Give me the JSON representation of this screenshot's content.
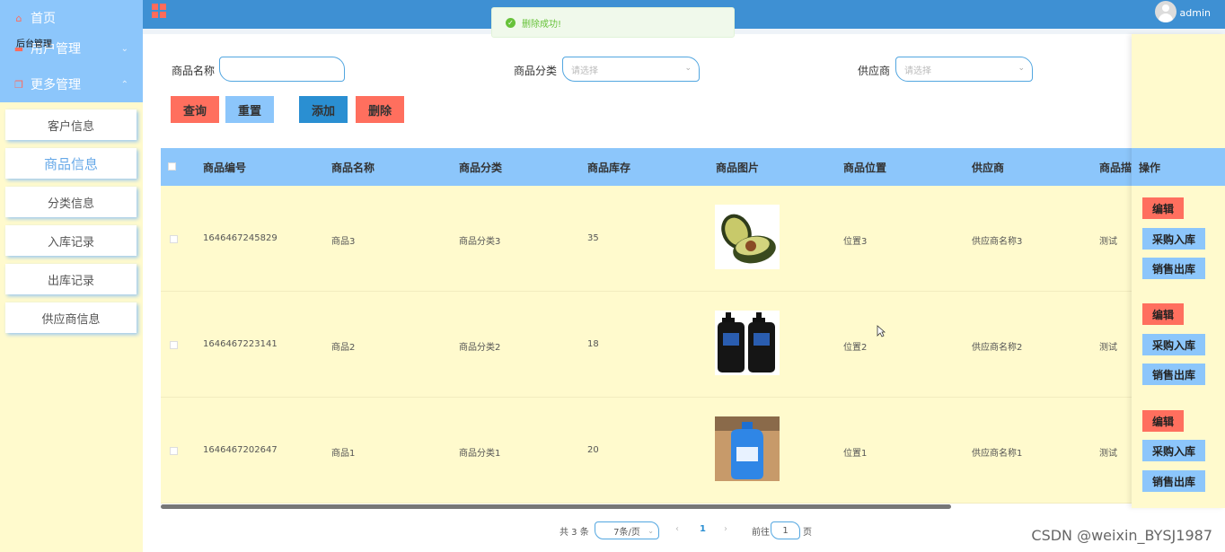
{
  "sidebar": {
    "home": "首页",
    "user_mgmt": "用户管理",
    "overlay_text": "后台管理",
    "more_mgmt": "更多管理",
    "items": [
      {
        "label": "客户信息"
      },
      {
        "label": "商品信息"
      },
      {
        "label": "分类信息"
      },
      {
        "label": "入库记录"
      },
      {
        "label": "出库记录"
      },
      {
        "label": "供应商信息"
      }
    ],
    "active_index": 1
  },
  "topbar": {
    "username": "admin"
  },
  "toast": {
    "message": "删除成功!"
  },
  "search": {
    "name_label": "商品名称",
    "name_value": "",
    "category_label": "商品分类",
    "category_placeholder": "请选择",
    "supplier_label": "供应商",
    "supplier_placeholder": "请选择"
  },
  "buttons": {
    "query": "查询",
    "reset": "重置",
    "add": "添加",
    "delete": "删除"
  },
  "table": {
    "headers": [
      "商品编号",
      "商品名称",
      "商品分类",
      "商品库存",
      "商品图片",
      "商品位置",
      "供应商",
      "商品描",
      "操作"
    ],
    "rows": [
      {
        "id": "1646467245829",
        "name": "商品3",
        "category": "商品分类3",
        "stock": "35",
        "image": "avocado-image",
        "location": "位置3",
        "supplier": "供应商名称3",
        "desc": "测试"
      },
      {
        "id": "1646467223141",
        "name": "商品2",
        "category": "商品分类2",
        "stock": "18",
        "image": "mens-bottles-image",
        "location": "位置2",
        "supplier": "供应商名称2",
        "desc": "测试"
      },
      {
        "id": "1646467202647",
        "name": "商品1",
        "category": "商品分类1",
        "stock": "20",
        "image": "detergent-image",
        "location": "位置1",
        "supplier": "供应商名称1",
        "desc": "测试"
      }
    ],
    "ops": {
      "edit": "编辑",
      "purchase_in": "采购入库",
      "sales_out": "销售出库"
    }
  },
  "pagination": {
    "total": "共 3 条",
    "page_size": "7条/页",
    "current": "1",
    "goto_prefix": "前往",
    "goto_value": "1",
    "goto_suffix": "页"
  },
  "watermark": "CSDN @weixin_BYSJ1987",
  "colors": {
    "sidebar_head": "#8cc6fb",
    "topbar": "#3e90d3",
    "table_head": "#8cc6fb",
    "row_bg": "#fffacd",
    "danger": "#ff6f5e",
    "primary": "#2a8fd2",
    "success": "#67c23a"
  }
}
